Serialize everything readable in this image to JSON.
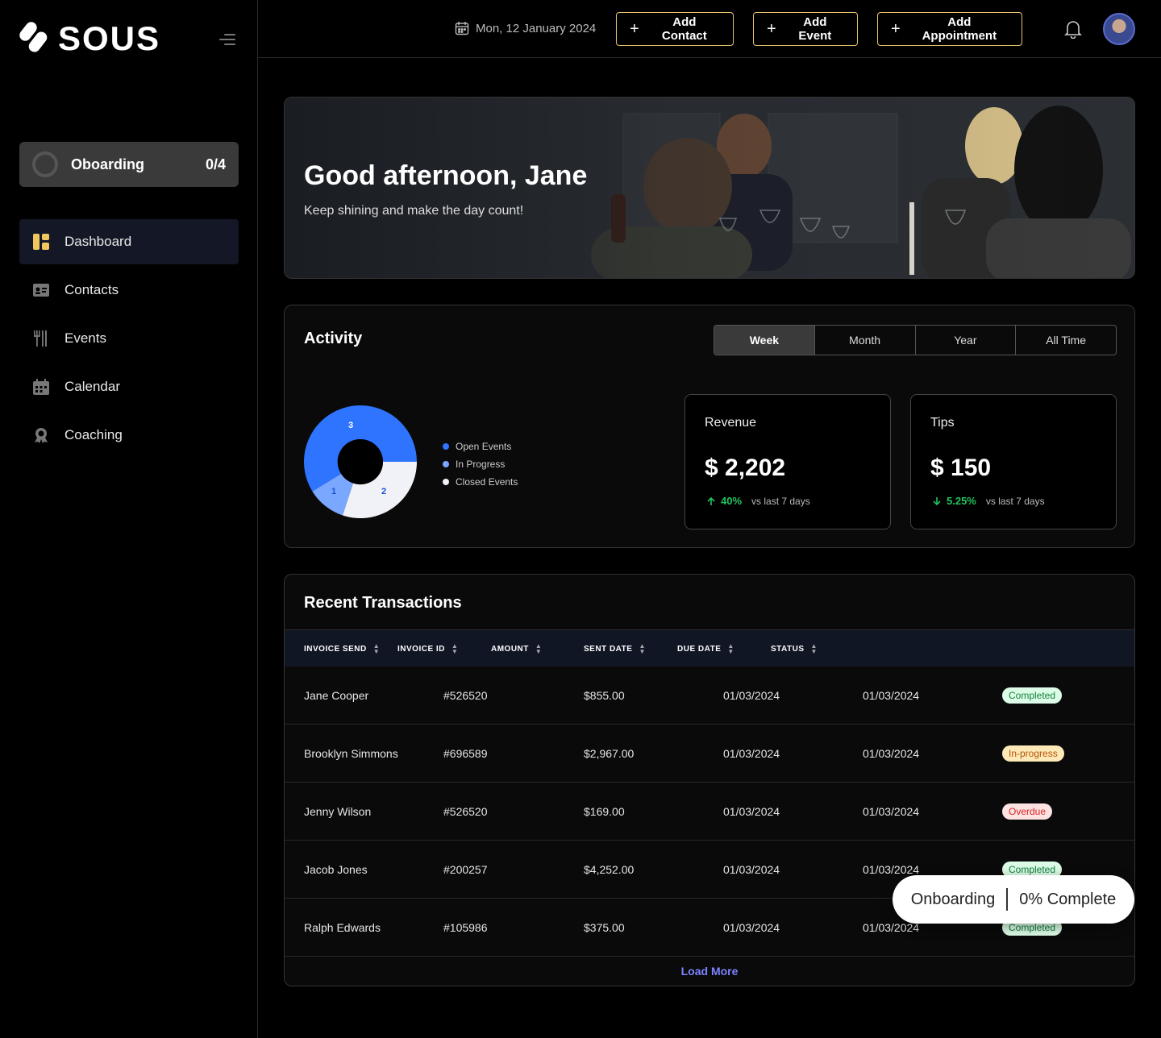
{
  "brand": {
    "name": "SOUS"
  },
  "sidebar": {
    "onboarding": {
      "label": "Oboarding",
      "count": "0/4"
    },
    "items": [
      {
        "label": "Dashboard",
        "icon": "dashboard-icon",
        "active": true
      },
      {
        "label": "Contacts",
        "icon": "contact-card-icon"
      },
      {
        "label": "Events",
        "icon": "utensils-icon"
      },
      {
        "label": "Calendar",
        "icon": "calendar-icon"
      },
      {
        "label": "Coaching",
        "icon": "award-icon"
      }
    ]
  },
  "topbar": {
    "date": "Mon, 12 January 2024",
    "buttons": {
      "add_contact": "Add Contact",
      "add_event": "Add Event",
      "add_appointment": "Add Appointment"
    },
    "accent": "#e8c46a"
  },
  "hero": {
    "greeting": "Good afternoon, Jane",
    "subtitle": "Keep shining and make the day count!"
  },
  "activity": {
    "title": "Activity",
    "periods": [
      "Week",
      "Month",
      "Year",
      "All Time"
    ],
    "selected_period": "Week",
    "legend": [
      "Open Events",
      "In Progress",
      "Closed Events"
    ],
    "donut": {
      "open": "3",
      "in_progress": "1",
      "closed": "2"
    },
    "colors": {
      "open": "#2f74ff",
      "in_progress": "#7aa7ff",
      "closed": "#f1f2f8"
    },
    "revenue": {
      "label": "Revenue",
      "value": "$ 2,202",
      "change": "40%",
      "compare": "vs last 7 days"
    },
    "tips": {
      "label": "Tips",
      "value": "$ 150",
      "change": "5.25%",
      "compare": "vs last 7 days"
    }
  },
  "transactions": {
    "title": "Recent Transactions",
    "columns": [
      "INVOICE SEND",
      "INVOICE ID",
      "AMOUNT",
      "SENT DATE",
      "DUE DATE",
      "STATUS"
    ],
    "rows": [
      {
        "name": "Jane Cooper",
        "id": "#526520",
        "amount": "$855.00",
        "sent": "01/03/2024",
        "due": "01/03/2024",
        "status": "Completed"
      },
      {
        "name": "Brooklyn Simmons",
        "id": "#696589",
        "amount": "$2,967.00",
        "sent": "01/03/2024",
        "due": "01/03/2024",
        "status": "In-progress"
      },
      {
        "name": "Jenny Wilson",
        "id": "#526520",
        "amount": "$169.00",
        "sent": "01/03/2024",
        "due": "01/03/2024",
        "status": "Overdue"
      },
      {
        "name": "Jacob Jones",
        "id": "#200257",
        "amount": "$4,252.00",
        "sent": "01/03/2024",
        "due": "01/03/2024",
        "status": "Completed"
      },
      {
        "name": "Ralph Edwards",
        "id": "#105986",
        "amount": "$375.00",
        "sent": "01/03/2024",
        "due": "01/03/2024",
        "status": "Completed"
      }
    ],
    "load_more": "Load More"
  },
  "toast": {
    "left": "Onboarding",
    "right": "0% Complete"
  }
}
